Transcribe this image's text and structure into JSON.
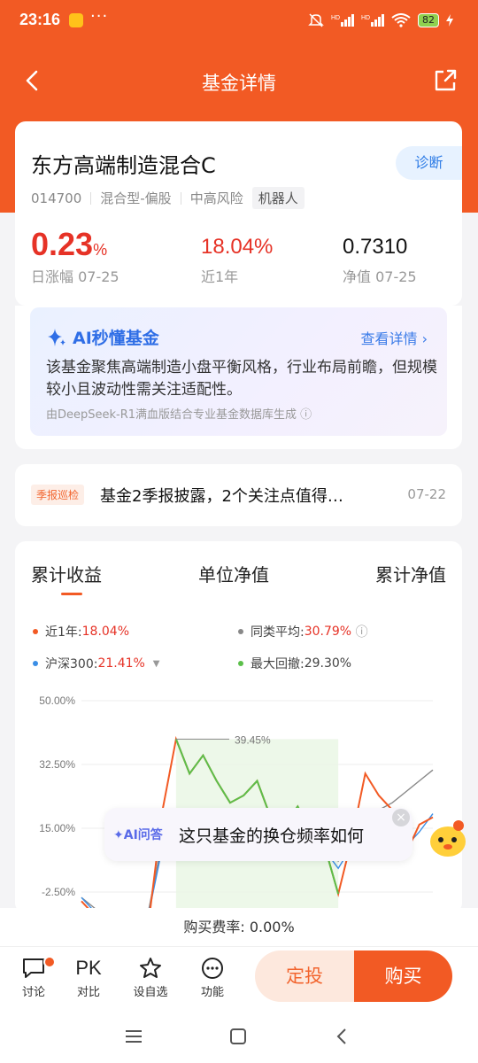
{
  "status_bar": {
    "time": "23:16",
    "dots": "···",
    "signal": "HD",
    "battery": "82"
  },
  "nav": {
    "title": "基金详情"
  },
  "fund": {
    "name": "东方高端制造混合C",
    "diagnose": "诊断",
    "code": "014700",
    "type": "混合型-偏股",
    "risk": "中高风险",
    "robot_tag": "机器人",
    "daily_change": "0.23",
    "daily_change_unit": "%",
    "daily_change_label": "日涨幅 07-25",
    "year_return": "18.04%",
    "year_return_label": "近1年",
    "nav": "0.7310",
    "nav_label": "净值 07-25"
  },
  "ai_card": {
    "title": "AI秒懂基金",
    "more": "查看详情",
    "body": "该基金聚焦高端制造小盘平衡风格，行业布局前瞻，但规模较小且波动性需关注适配性。",
    "footer": "由DeepSeek-R1满血版结合专业基金数据库生成"
  },
  "report": {
    "tag": "季报巡检",
    "text": "基金2季报披露，2个关注点值得…",
    "date": "07-22"
  },
  "chart_tabs": [
    "累计收益",
    "单位净值",
    "累计净值"
  ],
  "legend": {
    "fund_label": "近1年:",
    "fund_value": "18.04%",
    "peer_label": "同类平均:",
    "peer_value": "30.79%",
    "index_label": "沪深300:",
    "index_value": "21.41%",
    "dd_label": "最大回撤:",
    "dd_value": "29.30%"
  },
  "chart_data": {
    "type": "line",
    "ylim": [
      -2.5,
      50
    ],
    "yticks": [
      "50.00%",
      "32.50%",
      "15.00%",
      "-2.50%"
    ],
    "peak_annotation": "39.45%",
    "series": [
      {
        "name": "近1年",
        "color": "#f25a24",
        "values": [
          -5,
          -9,
          -10,
          -11,
          -12,
          -10,
          20,
          39.45,
          30,
          35,
          28,
          22,
          24,
          28,
          18,
          16,
          21,
          14,
          10,
          -3,
          12,
          30,
          24,
          20,
          8,
          16,
          18
        ]
      },
      {
        "name": "沪深300",
        "color": "#3a8ee6",
        "values": [
          -4,
          -8,
          -9,
          -10,
          -10,
          -8,
          10,
          18,
          16,
          18,
          14,
          12,
          13,
          15,
          12,
          11,
          13,
          11,
          9,
          4,
          10,
          14,
          13,
          12,
          10,
          14,
          19
        ]
      },
      {
        "name": "同类平均",
        "color": "#888888",
        "values": [
          -4,
          -7,
          -8,
          -9,
          -9,
          -7,
          12,
          20,
          18,
          20,
          17,
          15,
          16,
          18,
          15,
          14,
          16,
          14,
          12,
          6,
          12,
          18,
          20,
          22,
          25,
          28,
          31
        ]
      }
    ]
  },
  "ai_bubble": {
    "tag": "AI问答",
    "question": "这只基金的换仓频率如何"
  },
  "fee": "购买费率: 0.00%",
  "bottom_bar": {
    "discuss": "讨论",
    "compare_icon": "PK",
    "compare": "对比",
    "watch": "设自选",
    "func": "功能",
    "sip": "定投",
    "buy": "购买"
  }
}
